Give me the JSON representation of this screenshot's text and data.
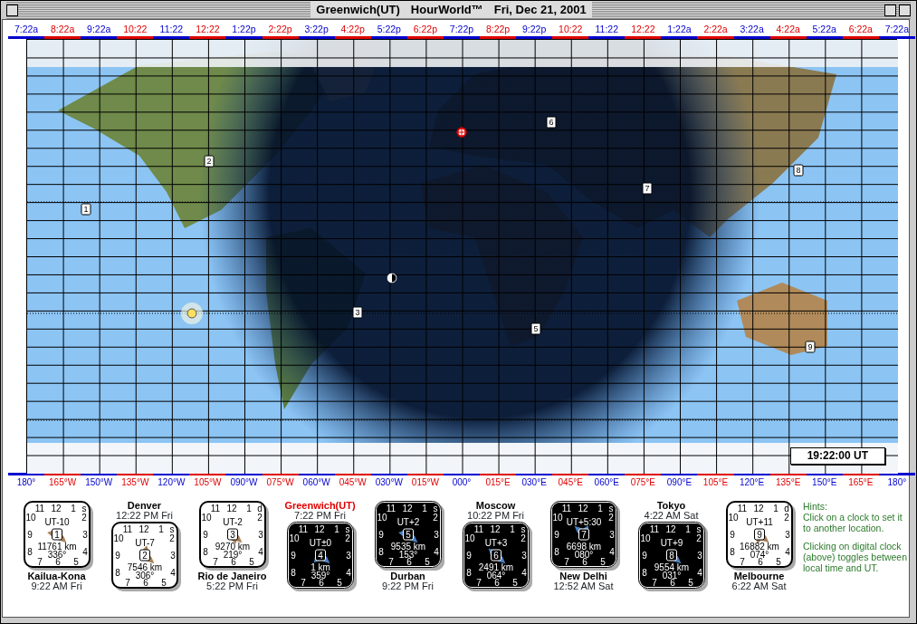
{
  "window": {
    "title": [
      "Greenwich(UT)",
      "HourWorld™",
      "Fri, Dec 21, 2001"
    ]
  },
  "hour_scale": [
    {
      "label": "7:22a",
      "color": "#0000d0"
    },
    {
      "label": "8:22a",
      "color": "#e00000"
    },
    {
      "label": "9:22a",
      "color": "#0000d0"
    },
    {
      "label": "10:22",
      "color": "#e00000"
    },
    {
      "label": "11:22",
      "color": "#0000d0"
    },
    {
      "label": "12:22",
      "color": "#e00000"
    },
    {
      "label": "1:22p",
      "color": "#0000d0"
    },
    {
      "label": "2:22p",
      "color": "#e00000"
    },
    {
      "label": "3:22p",
      "color": "#0000d0"
    },
    {
      "label": "4:22p",
      "color": "#e00000"
    },
    {
      "label": "5:22p",
      "color": "#0000d0"
    },
    {
      "label": "6:22p",
      "color": "#e00000"
    },
    {
      "label": "7:22p",
      "color": "#0000d0"
    },
    {
      "label": "8:22p",
      "color": "#e00000"
    },
    {
      "label": "9:22p",
      "color": "#0000d0"
    },
    {
      "label": "10:22",
      "color": "#e00000"
    },
    {
      "label": "11:22",
      "color": "#0000d0"
    },
    {
      "label": "12:22",
      "color": "#e00000"
    },
    {
      "label": "1:22a",
      "color": "#0000d0"
    },
    {
      "label": "2:22a",
      "color": "#e00000"
    },
    {
      "label": "3:22a",
      "color": "#0000d0"
    },
    {
      "label": "4:22a",
      "color": "#e00000"
    },
    {
      "label": "5:22a",
      "color": "#0000d0"
    },
    {
      "label": "6:22a",
      "color": "#e00000"
    },
    {
      "label": "7:22a",
      "color": "#0000d0"
    }
  ],
  "map": {
    "markers": [
      {
        "label": "1"
      },
      {
        "label": "2"
      },
      {
        "label": "3"
      },
      {
        "label": "5"
      },
      {
        "label": "6"
      },
      {
        "label": "7"
      },
      {
        "label": "8"
      },
      {
        "label": "9"
      }
    ],
    "digital_clock": "19:22:00 UT"
  },
  "longitude_scale": [
    {
      "label": "180°",
      "color": "#0000d0"
    },
    {
      "label": "165°W",
      "color": "#e00000"
    },
    {
      "label": "150°W",
      "color": "#0000d0"
    },
    {
      "label": "135°W",
      "color": "#e00000"
    },
    {
      "label": "120°W",
      "color": "#0000d0"
    },
    {
      "label": "105°W",
      "color": "#e00000"
    },
    {
      "label": "090°W",
      "color": "#0000d0"
    },
    {
      "label": "075°W",
      "color": "#e00000"
    },
    {
      "label": "060°W",
      "color": "#0000d0"
    },
    {
      "label": "045°W",
      "color": "#e00000"
    },
    {
      "label": "030°W",
      "color": "#0000d0"
    },
    {
      "label": "015°W",
      "color": "#e00000"
    },
    {
      "label": "000°",
      "color": "#0000d0"
    },
    {
      "label": "015°E",
      "color": "#e00000"
    },
    {
      "label": "030°E",
      "color": "#0000d0"
    },
    {
      "label": "045°E",
      "color": "#e00000"
    },
    {
      "label": "060°E",
      "color": "#0000d0"
    },
    {
      "label": "075°E",
      "color": "#e00000"
    },
    {
      "label": "090°E",
      "color": "#0000d0"
    },
    {
      "label": "105°E",
      "color": "#e00000"
    },
    {
      "label": "120°E",
      "color": "#0000d0"
    },
    {
      "label": "135°E",
      "color": "#e00000"
    },
    {
      "label": "150°E",
      "color": "#0000d0"
    },
    {
      "label": "165°E",
      "color": "#e00000"
    },
    {
      "label": "180°",
      "color": "#0000d0"
    }
  ],
  "clocks": [
    {
      "name": "Kailua-Kona",
      "time": "9:22 AM Fri",
      "offset": "UT-10",
      "number": "1",
      "distance": "11761 km",
      "bearing": "336°",
      "dst": "s",
      "night": false,
      "selected": false,
      "dial": [
        "11",
        "12",
        "1",
        "10",
        "2",
        "9",
        "3",
        "8",
        "4",
        "7",
        "6",
        "5"
      ]
    },
    {
      "name": "Denver",
      "time": "12:22 PM Fri",
      "offset": "UT-7",
      "number": "2",
      "distance": "7546 km",
      "bearing": "306°",
      "dst": "s",
      "night": false,
      "selected": false,
      "dial": [
        "11",
        "12",
        "1",
        "10",
        "2",
        "9",
        "3",
        "8",
        "4",
        "7",
        "6",
        "5"
      ]
    },
    {
      "name": "Rio de Janeiro",
      "time": "5:22 PM Fri",
      "offset": "UT-2",
      "number": "3",
      "distance": "9270 km",
      "bearing": "219°",
      "dst": "d",
      "night": false,
      "selected": false,
      "dial": [
        "11",
        "12",
        "1",
        "10",
        "2",
        "9",
        "3",
        "8",
        "4",
        "7",
        "6",
        "5"
      ]
    },
    {
      "name": "Greenwich(UT)",
      "time": "7:22 PM Fri",
      "offset": "UT±0",
      "number": "4",
      "distance": "1 km",
      "bearing": "359°",
      "dst": "s",
      "night": true,
      "selected": true,
      "dial": [
        "11",
        "12",
        "1",
        "10",
        "2",
        "9",
        "3",
        "8",
        "4",
        "7",
        "6",
        "5"
      ]
    },
    {
      "name": "Durban",
      "time": "9:22 PM Fri",
      "offset": "UT+2",
      "number": "5",
      "distance": "9535 km",
      "bearing": "153°",
      "dst": "s",
      "night": true,
      "selected": false,
      "dial": [
        "11",
        "12",
        "1",
        "10",
        "2",
        "9",
        "3",
        "8",
        "4",
        "7",
        "6",
        "5"
      ]
    },
    {
      "name": "Moscow",
      "time": "10:22 PM Fri",
      "offset": "UT+3",
      "number": "6",
      "distance": "2491 km",
      "bearing": "064°",
      "dst": "s",
      "night": true,
      "selected": false,
      "dial": [
        "11",
        "12",
        "1",
        "10",
        "2",
        "9",
        "3",
        "8",
        "4",
        "7",
        "6",
        "5"
      ]
    },
    {
      "name": "New Delhi",
      "time": "12:52 AM Sat",
      "offset": "UT+5:30",
      "number": "7",
      "distance": "6698 km",
      "bearing": "080°",
      "dst": "s",
      "night": true,
      "selected": false,
      "dial": [
        "11",
        "12",
        "1",
        "10",
        "2",
        "9",
        "3",
        "8",
        "4",
        "7",
        "6",
        "5"
      ]
    },
    {
      "name": "Tokyo",
      "time": "4:22 AM Sat",
      "offset": "UT+9",
      "number": "8",
      "distance": "9554 km",
      "bearing": "031°",
      "dst": "s",
      "night": true,
      "selected": false,
      "dial": [
        "11",
        "12",
        "1",
        "10",
        "2",
        "9",
        "3",
        "8",
        "4",
        "7",
        "6",
        "5"
      ]
    },
    {
      "name": "Melbourne",
      "time": "6:22 AM Sat",
      "offset": "UT+11",
      "number": "9",
      "distance": "16882 km",
      "bearing": "074°",
      "dst": "d",
      "night": false,
      "selected": false,
      "dial": [
        "11",
        "12",
        "1",
        "10",
        "2",
        "9",
        "3",
        "8",
        "4",
        "7",
        "6",
        "5"
      ]
    }
  ],
  "hints": {
    "title": "Hints:",
    "paragraphs": [
      "Click on a clock to set it to another location.",
      "Clicking on digital clock (above) toggles between local time and UT."
    ]
  }
}
